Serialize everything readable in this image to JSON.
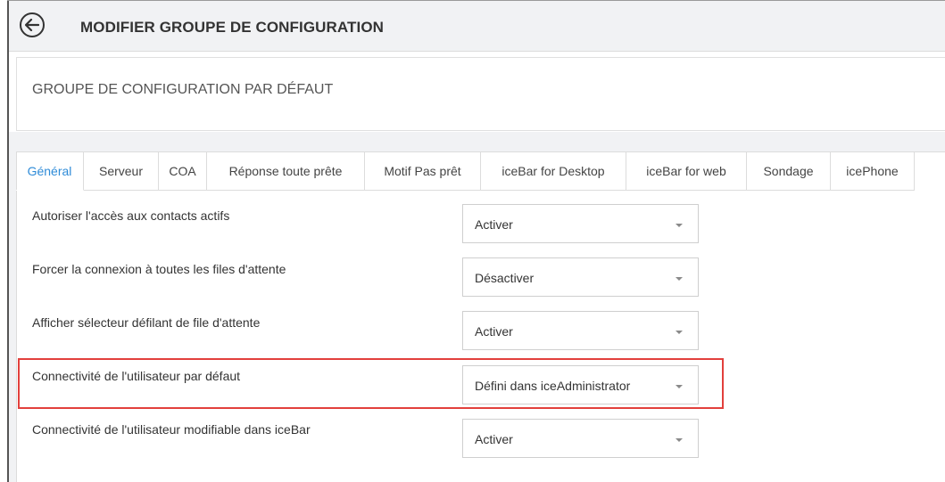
{
  "header": {
    "title": "MODIFIER GROUPE DE CONFIGURATION",
    "back_icon": "arrow-left-circle-icon"
  },
  "group": {
    "name": "GROUPE DE CONFIGURATION PAR DÉFAUT"
  },
  "tabs": [
    {
      "label": "Général",
      "active": true
    },
    {
      "label": "Serveur"
    },
    {
      "label": "COA"
    },
    {
      "label": "Réponse toute prête"
    },
    {
      "label": "Motif Pas prêt"
    },
    {
      "label": "iceBar for Desktop"
    },
    {
      "label": "iceBar for web"
    },
    {
      "label": "Sondage"
    },
    {
      "label": "icePhone"
    }
  ],
  "settings": [
    {
      "label": "Autoriser l'accès aux contacts actifs",
      "value": "Activer"
    },
    {
      "label": "Forcer la connexion à toutes les files d'attente",
      "value": "Désactiver"
    },
    {
      "label": "Afficher sélecteur défilant de file d'attente",
      "value": "Activer"
    },
    {
      "label": "Connectivité de l'utilisateur par défaut",
      "value": "Défini dans iceAdministrator"
    },
    {
      "label": "Connectivité de l'utilisateur modifiable dans iceBar",
      "value": "Activer"
    }
  ],
  "colors": {
    "accent": "#2e8bd8",
    "highlight": "#e2403c",
    "header_bg": "#f1f2f4"
  }
}
